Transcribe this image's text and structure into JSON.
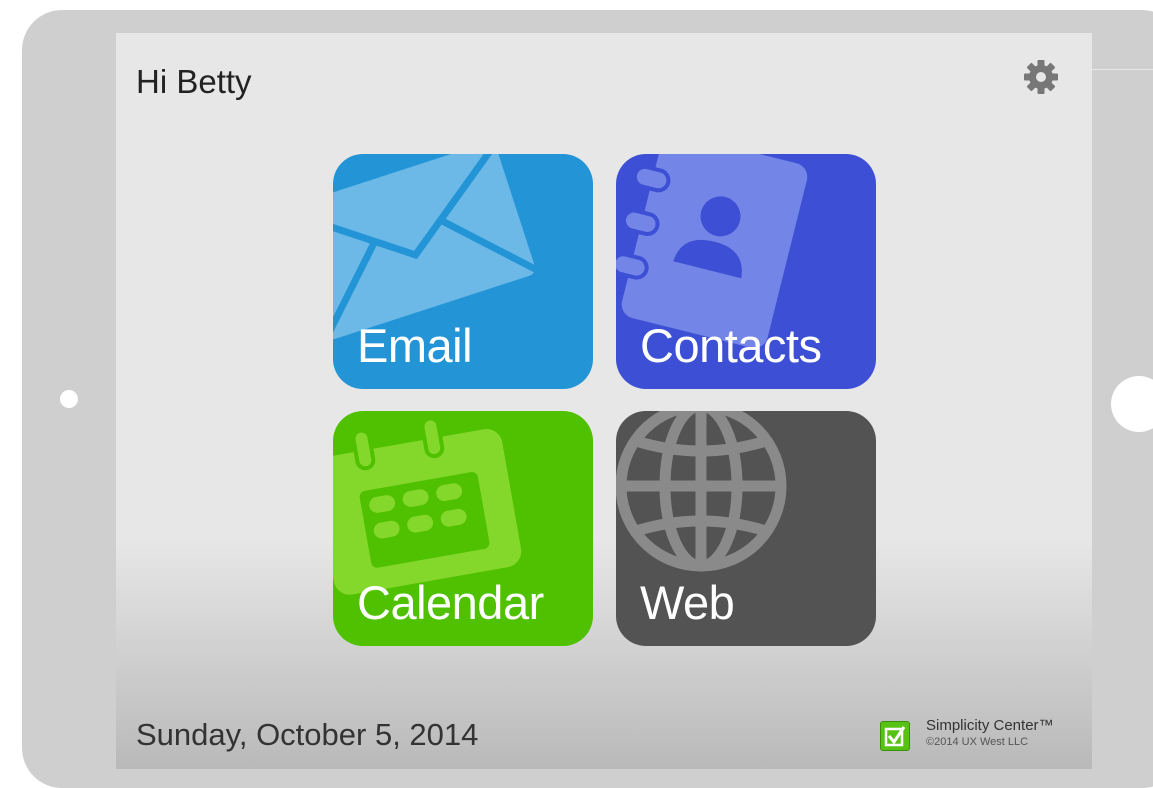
{
  "header": {
    "greeting": "Hi Betty"
  },
  "tiles": [
    {
      "label": "Email",
      "color": "#2395d6",
      "icon": "envelope-icon"
    },
    {
      "label": "Contacts",
      "color": "#3d4fd4",
      "icon": "address-book-icon"
    },
    {
      "label": "Calendar",
      "color": "#4fc100",
      "icon": "calendar-icon"
    },
    {
      "label": "Web",
      "color": "#535353",
      "icon": "globe-icon"
    }
  ],
  "footer": {
    "date": "Sunday, October 5, 2014",
    "brand_name": "Simplicity Center™",
    "brand_copyright": "©2014 UX West LLC"
  },
  "settings_icon": "gear-icon"
}
